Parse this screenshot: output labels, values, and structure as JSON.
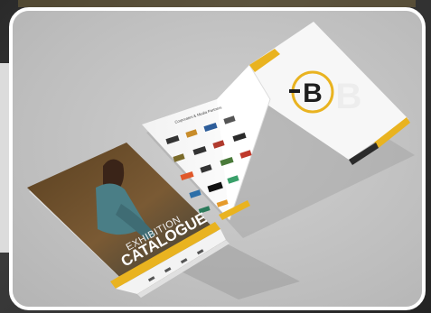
{
  "catalogue": {
    "cover_word_1": "EXHIBITION",
    "cover_word_2": "CATALOGUE",
    "cover_year": "2023",
    "sponsor_heading": "Corporates & Media Partners",
    "logo_letter": "B"
  },
  "colors": {
    "accent_gold": "#e9b320",
    "dark": "#2b2b2b",
    "paper": "#f7f7f7",
    "frame": "#ffffff"
  }
}
